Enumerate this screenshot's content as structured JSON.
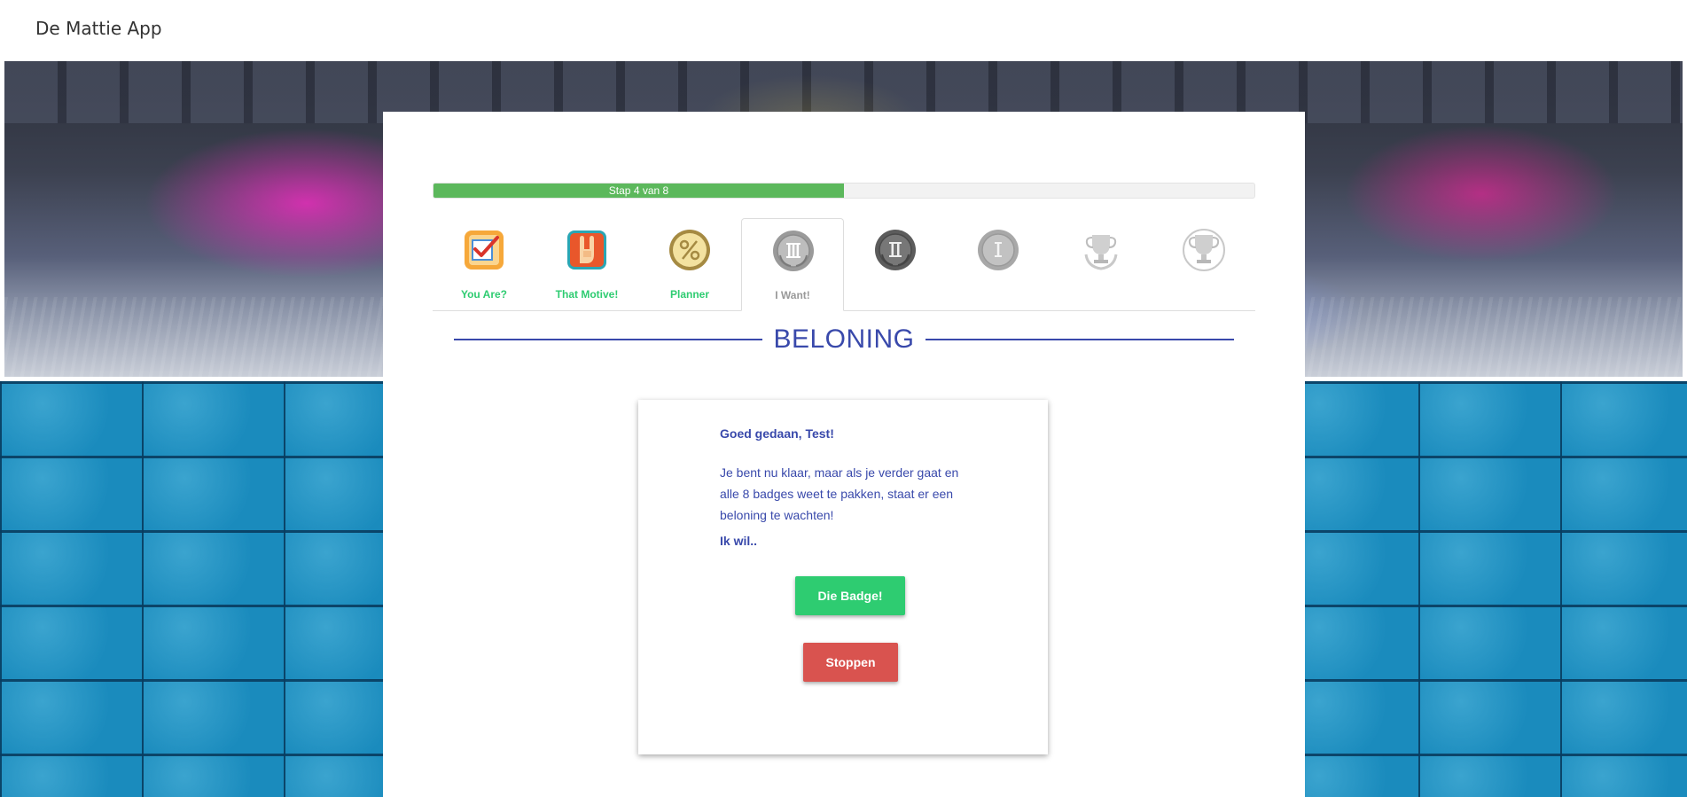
{
  "header": {
    "title": "De Mattie App"
  },
  "progress": {
    "label": "Stap 4 van 8",
    "current": 4,
    "total": 8,
    "fraction": 0.5
  },
  "steps": [
    {
      "label": "You Are?",
      "icon": "checklist-icon",
      "status": "done"
    },
    {
      "label": "That Motive!",
      "icon": "rock-hand-icon",
      "status": "done"
    },
    {
      "label": "Planner",
      "icon": "percent-badge-icon",
      "status": "done"
    },
    {
      "label": "I Want!",
      "icon": "roman-three-medal-icon",
      "status": "active"
    },
    {
      "label": "",
      "icon": "roman-two-medal-icon",
      "status": "locked"
    },
    {
      "label": "",
      "icon": "roman-one-medal-icon",
      "status": "locked"
    },
    {
      "label": "",
      "icon": "trophy-badge-icon",
      "status": "locked"
    },
    {
      "label": "",
      "icon": "trophy-badge-icon",
      "status": "locked"
    }
  ],
  "section": {
    "title": "BELONING"
  },
  "card": {
    "greeting": "Goed gedaan, Test!",
    "body": "Je bent nu klaar, maar als je verder gaat en alle 8 badges weet te pakken, staat er een beloning te wachten!",
    "prompt": "Ik wil..",
    "badge_button": "Die Badge!",
    "stop_button": "Stoppen"
  },
  "colors": {
    "accent": "#3949ab",
    "success": "#2ecc71",
    "progress": "#5cb85c",
    "danger": "#d9534f"
  }
}
